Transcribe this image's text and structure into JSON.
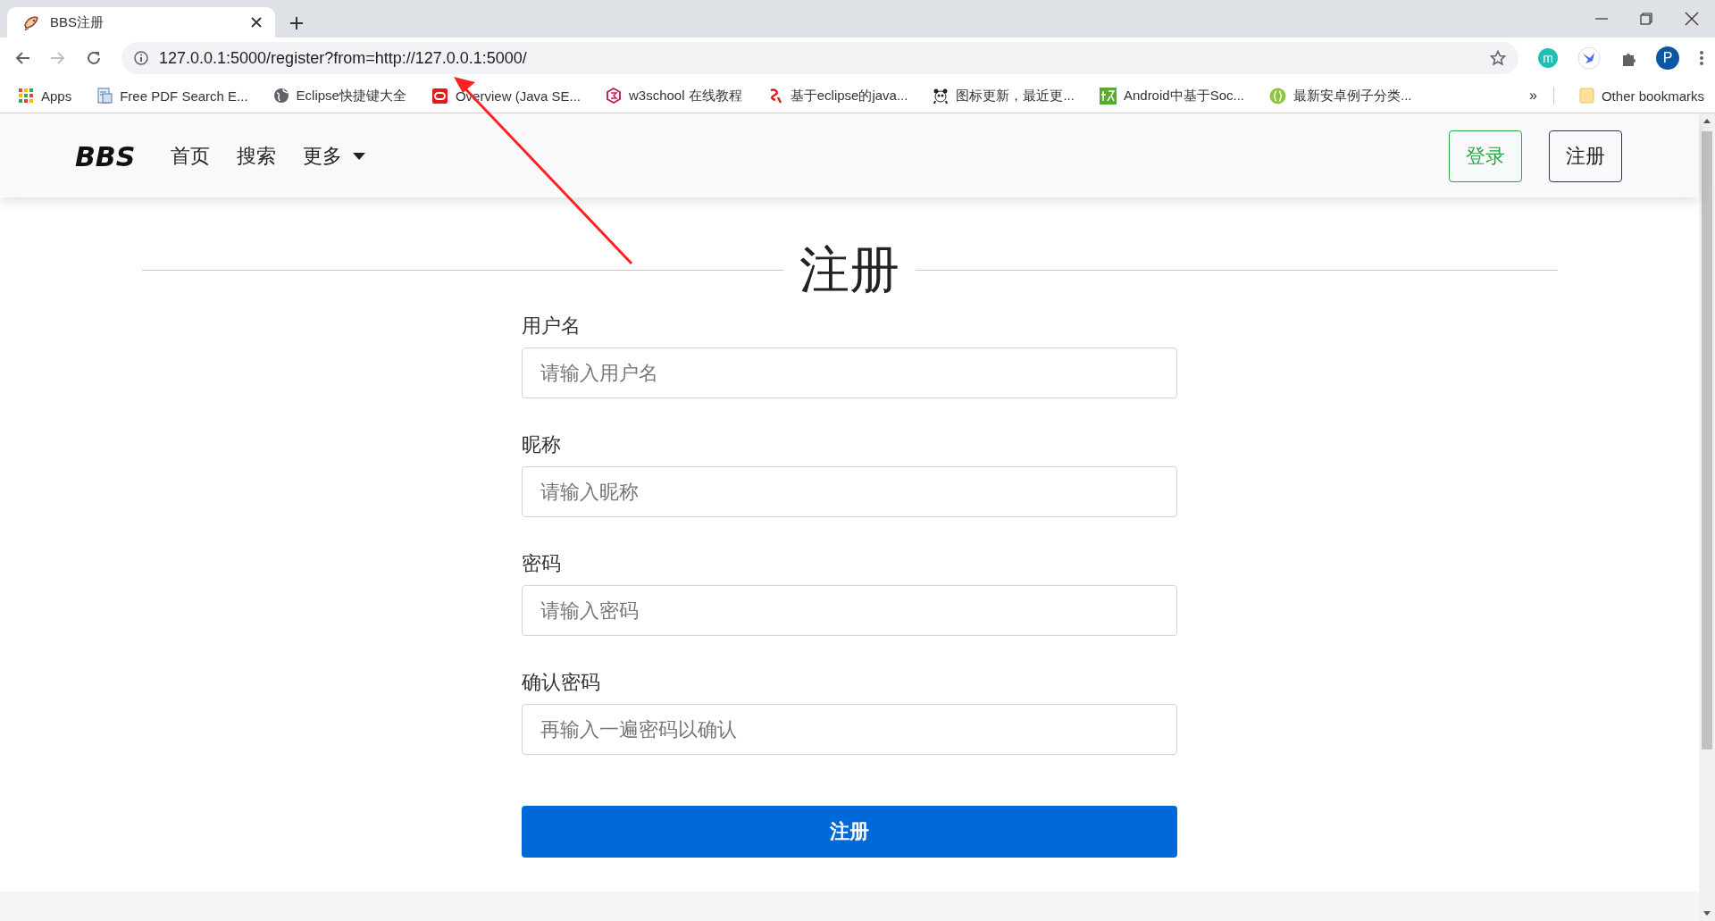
{
  "browser": {
    "tab": {
      "title": "BBS注册",
      "selected": true
    },
    "address": "127.0.0.1:5000/register?from=http://127.0.0.1:5000/",
    "bookmarks": [
      {
        "label": "Apps"
      },
      {
        "label": "Free PDF Search E..."
      },
      {
        "label": "Eclipse快捷键大全"
      },
      {
        "label": "Overview (Java SE..."
      },
      {
        "label": "w3school 在线教程"
      },
      {
        "label": "基于eclipse的java..."
      },
      {
        "label": "图标更新，最近更..."
      },
      {
        "label": "Android中基于Soc..."
      },
      {
        "label": "最新安卓例子分类..."
      }
    ],
    "overflow": "»",
    "other_bookmarks": "Other bookmarks",
    "extension_letter": "m",
    "profile_initial": "P"
  },
  "navbar": {
    "brand": "BBS",
    "links": [
      {
        "label": "首页",
        "kind": "link"
      },
      {
        "label": "搜索",
        "kind": "link"
      },
      {
        "label": "更多",
        "kind": "dropdown"
      }
    ],
    "buttons": [
      {
        "label": "登录",
        "kind": "success"
      },
      {
        "label": "注册",
        "kind": "dark"
      }
    ]
  },
  "form": {
    "title": "注册",
    "fields": [
      {
        "label": "用户名",
        "placeholder": "请输入用户名"
      },
      {
        "label": "昵称",
        "placeholder": "请输入昵称"
      },
      {
        "label": "密码",
        "placeholder": "请输入密码"
      },
      {
        "label": "确认密码",
        "placeholder": "再输入一遍密码以确认"
      }
    ],
    "submit": "注册"
  }
}
